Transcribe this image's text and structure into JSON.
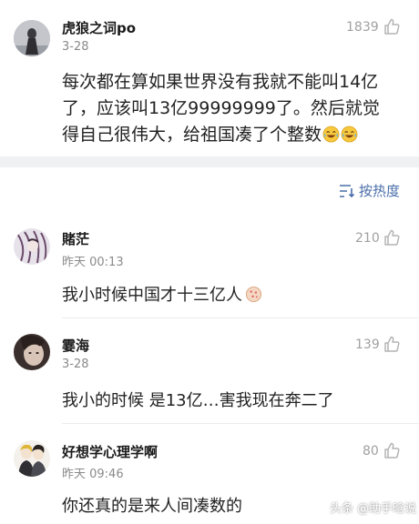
{
  "post": {
    "author": "虎狼之词po",
    "time": "3-28",
    "likes": "1839",
    "text_lines": [
      "每次都在算如果世界没有我就不能叫14亿",
      "了，应该叫13亿99999999了。然后就觉",
      "得自己很伟大，给祖国凑了个整数"
    ],
    "emojis": [
      "laughing-crying-icon",
      "laughing-crying-icon"
    ]
  },
  "sort": {
    "label": "按热度",
    "icon": "sort-icon"
  },
  "comments": [
    {
      "author": "賭茫",
      "time": "昨天 00:13",
      "likes": "210",
      "text": "我小时候中国才十三亿人",
      "emoji": "cookie-icon"
    },
    {
      "author": "霎海",
      "time": "3-28",
      "likes": "139",
      "text": "我小的时候 是13亿…害我现在奔二了"
    },
    {
      "author": "好想学心理学啊",
      "time": "昨天 09:46",
      "likes": "80",
      "text": "你还真的是来人间凑数的"
    }
  ],
  "watermark": "头条 @助手晗说",
  "colors": {
    "accent": "#4a6ea9",
    "muted": "#8a8a8a",
    "divider": "#f0f1f3"
  }
}
